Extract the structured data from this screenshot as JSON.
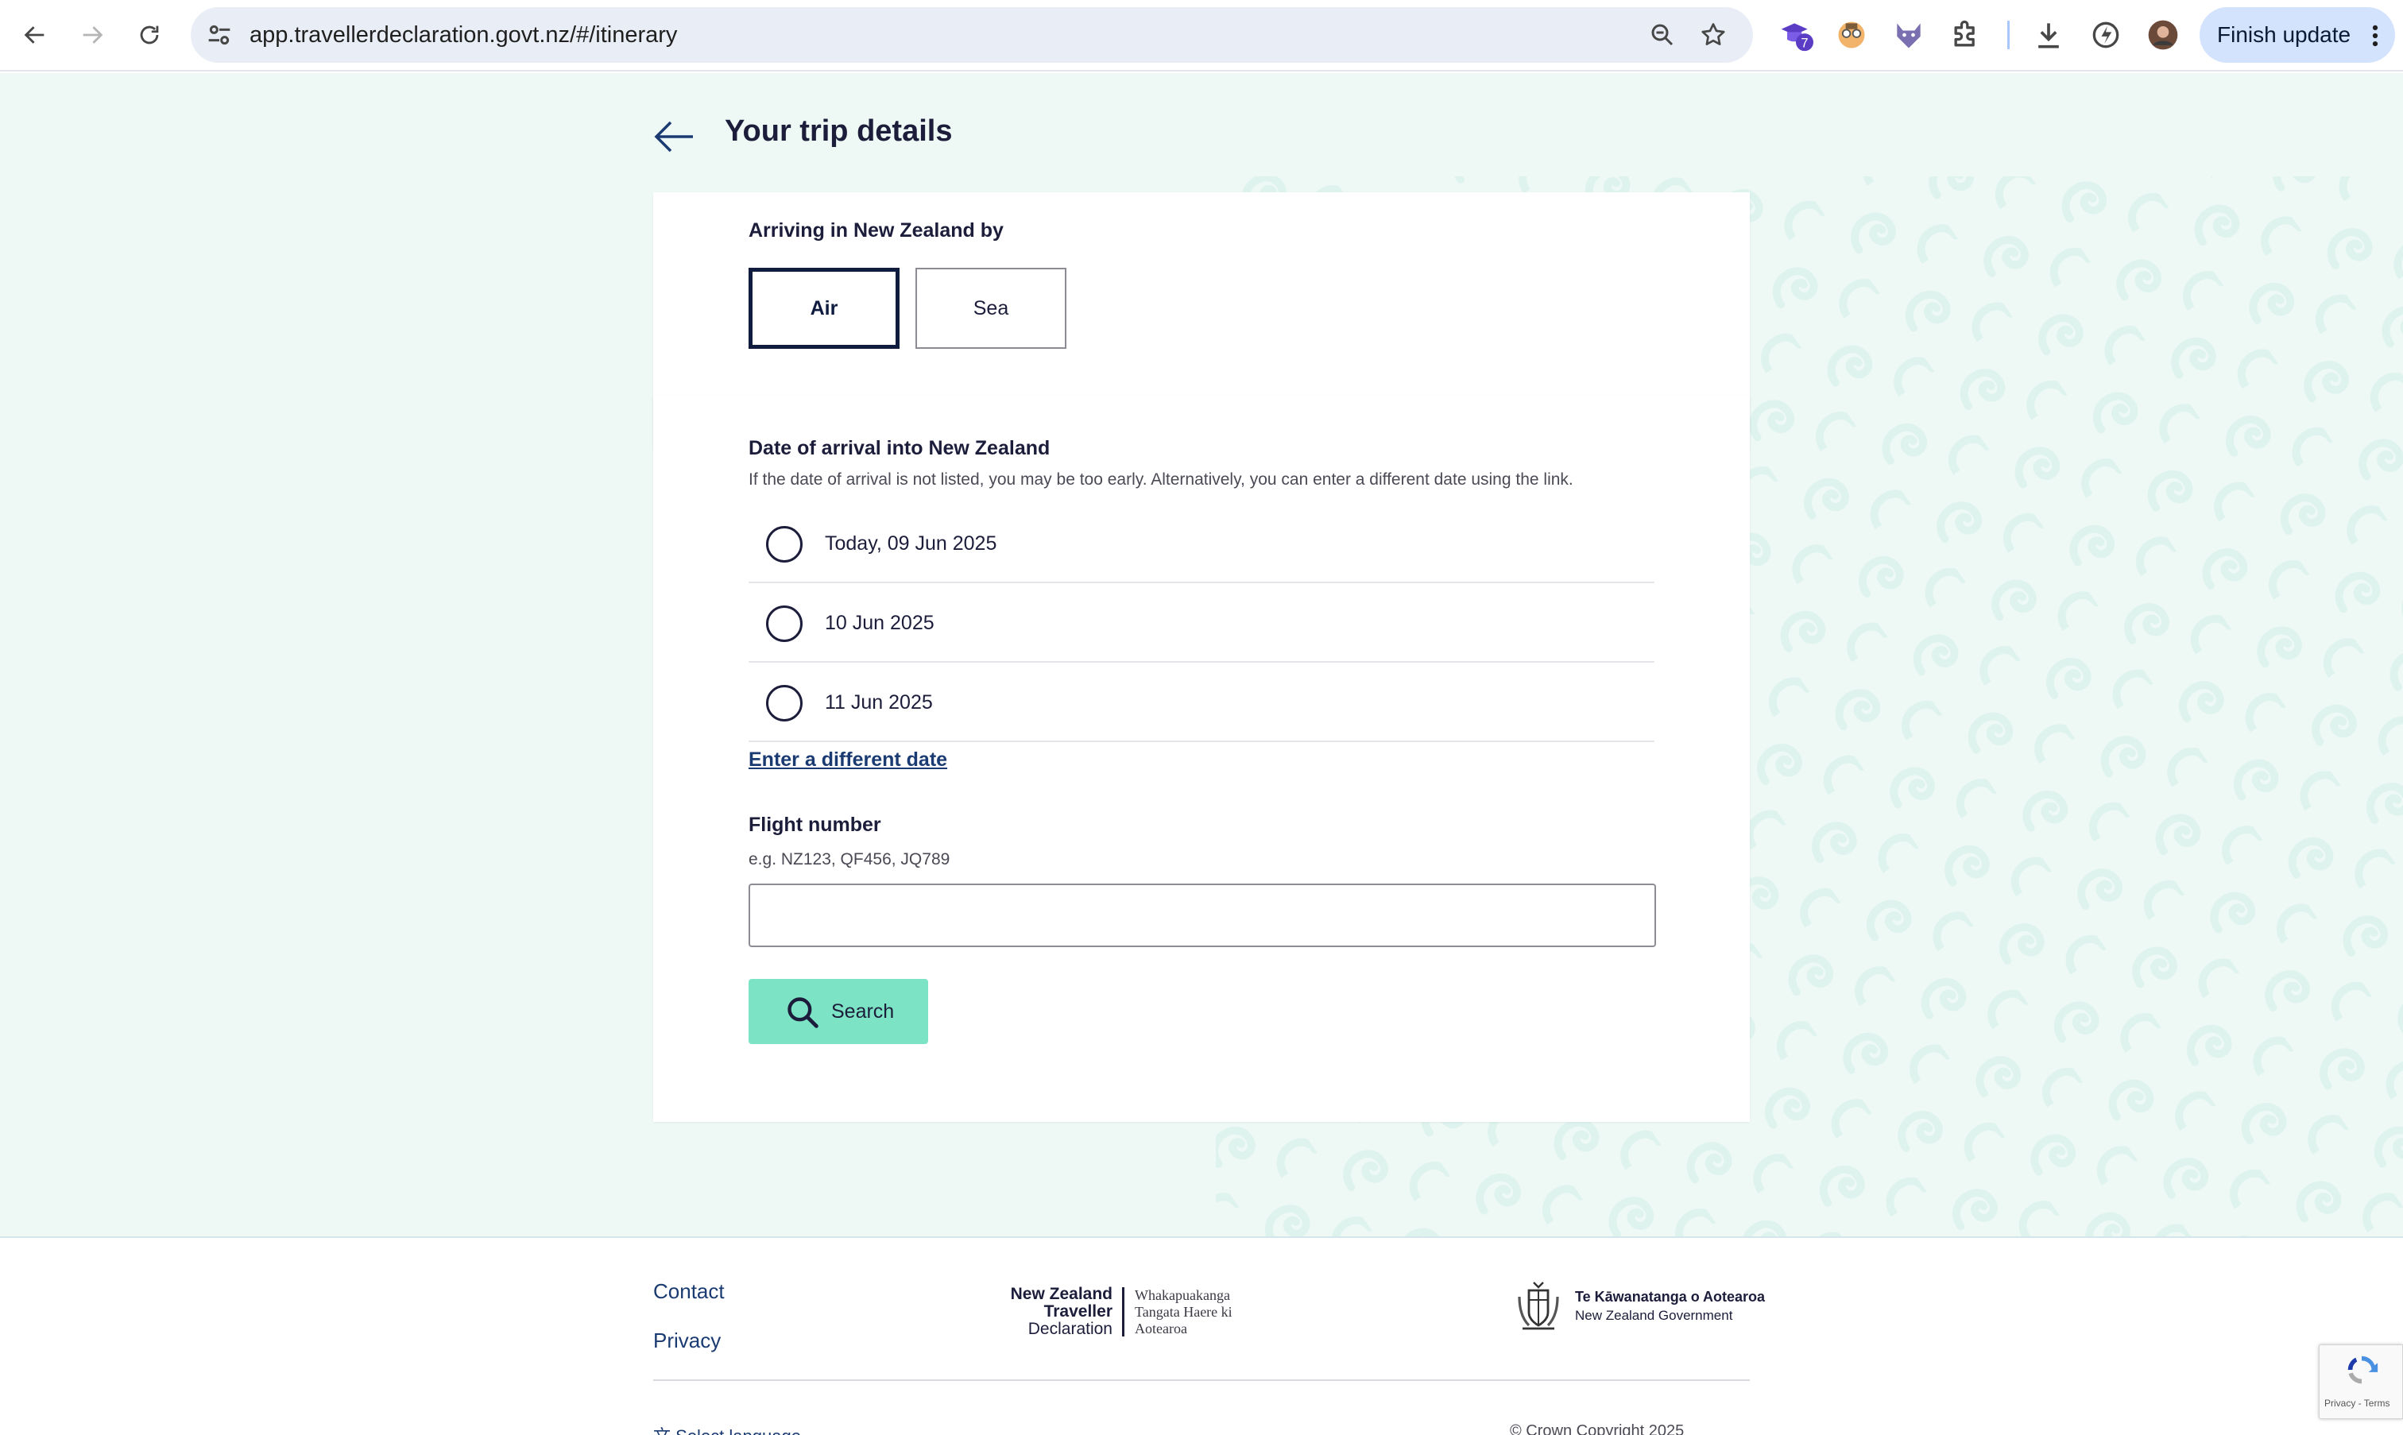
{
  "browser": {
    "url": "app.travellerdeclaration.govt.nz/#/itinerary",
    "extension_badge": "7",
    "update_button": "Finish update"
  },
  "page": {
    "title": "Your trip details"
  },
  "arrival_mode": {
    "label": "Arriving in New Zealand by",
    "options": [
      "Air",
      "Sea"
    ],
    "selected": "Air"
  },
  "arrival_date": {
    "label": "Date of arrival into New Zealand",
    "hint": "If the date of arrival is not listed, you may be too early. Alternatively, you can enter a different date using the link.",
    "options": [
      "Today, 09 Jun 2025",
      "10 Jun 2025",
      "11 Jun 2025"
    ],
    "different_date_link": "Enter a different date"
  },
  "flight": {
    "label": "Flight number",
    "hint": "e.g. NZ123, QF456, JQ789",
    "value": "",
    "search_button": "Search"
  },
  "footer": {
    "links": [
      "Contact",
      "Privacy"
    ],
    "traveller_logo_en": [
      "New Zealand",
      "Traveller",
      "Declaration"
    ],
    "traveller_logo_mi": [
      "Whakapuakanga",
      "Tangata Haere ki",
      "Aotearoa"
    ],
    "govt_logo_mi": "Te Kāwanatanga o Aotearoa",
    "govt_logo_en": "New Zealand Government",
    "select_language": "Select language",
    "copyright": "© Crown Copyright 2025",
    "recaptcha": "Privacy - Terms"
  },
  "colors": {
    "page_background": "#eef9f6",
    "accent_search": "#7ce3c5",
    "navy": "#0f1c3f",
    "link": "#1a3a72"
  },
  "icons": [
    "back-icon",
    "forward-icon",
    "reload-icon",
    "site-info-icon",
    "zoom-icon",
    "bookmark-star-icon",
    "extension-badge-icon",
    "extension-face-icon",
    "extension-fox-icon",
    "puzzle-icon",
    "download-icon",
    "performance-icon",
    "profile-avatar-icon",
    "more-vert-icon",
    "search-icon",
    "recaptcha-icon"
  ]
}
